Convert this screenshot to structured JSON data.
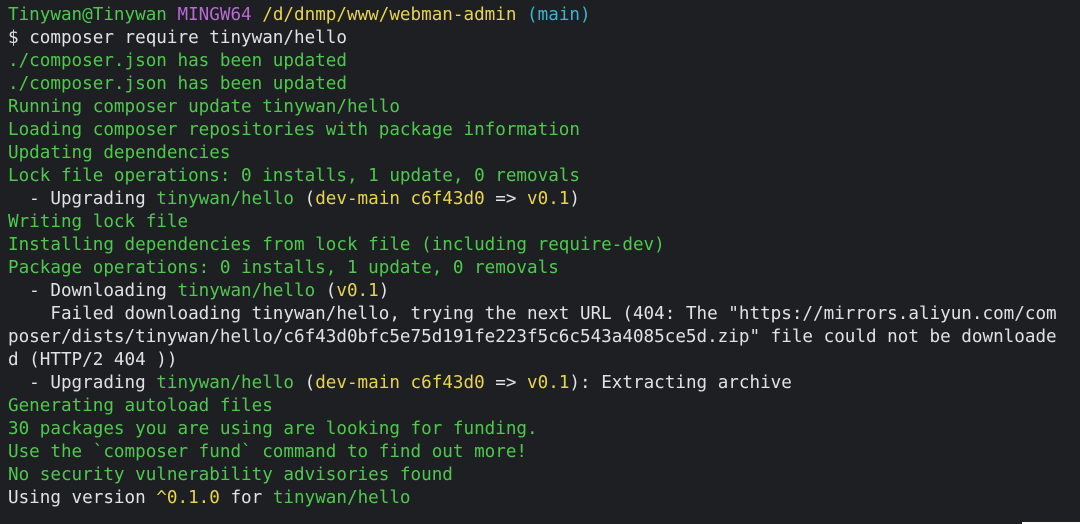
{
  "prompt": {
    "user_host": "Tinywan@Tinywan",
    "shell": "MINGW64",
    "path": "/d/dnmp/www/webman-admin",
    "branch": "(main)"
  },
  "command": {
    "symbol": "$",
    "text": "composer require tinywan/hello"
  },
  "output": {
    "line1": "./composer.json has been updated",
    "line2": "./composer.json has been updated",
    "line3": "Running composer update tinywan/hello",
    "line4": "Loading composer repositories with package information",
    "line5": "Updating dependencies",
    "line6": "Lock file operations: 0 installs, 1 update, 0 removals",
    "upgrade1": {
      "prefix": "  - Upgrading ",
      "pkg": "tinywan/hello",
      "open": " (",
      "from": "dev-main c6f43d0",
      "arrow": " => ",
      "to": "v0.1",
      "close": ")"
    },
    "line8": "Writing lock file",
    "line9": "Installing dependencies from lock file (including require-dev)",
    "line10": "Package operations: 0 installs, 1 update, 0 removals",
    "download": {
      "prefix": "  - Downloading ",
      "pkg": "tinywan/hello",
      "open": " (",
      "version": "v0.1",
      "close": ")"
    },
    "failed1": "    Failed downloading tinywan/hello, trying the next URL (404: The \"https://mirrors.aliyun.com/com",
    "failed2": "poser/dists/tinywan/hello/c6f43d0bfc5e75d191fe223f5c6c543a4085ce5d.zip\" file could not be downloade",
    "failed3": "d (HTTP/2 404 ))",
    "upgrade2": {
      "prefix": "  - Upgrading ",
      "pkg": "tinywan/hello",
      "open": " (",
      "from": "dev-main c6f43d0",
      "arrow": " => ",
      "to": "v0.1",
      "close": "): Extracting archive"
    },
    "line16": "Generating autoload files",
    "line17": "30 packages you are using are looking for funding.",
    "line18": "Use the `composer fund` command to find out more!",
    "line19": "No security vulnerability advisories found",
    "using": {
      "prefix": "Using version ",
      "version": "^0.1.0",
      "mid": " for ",
      "pkg": "tinywan/hello"
    }
  }
}
